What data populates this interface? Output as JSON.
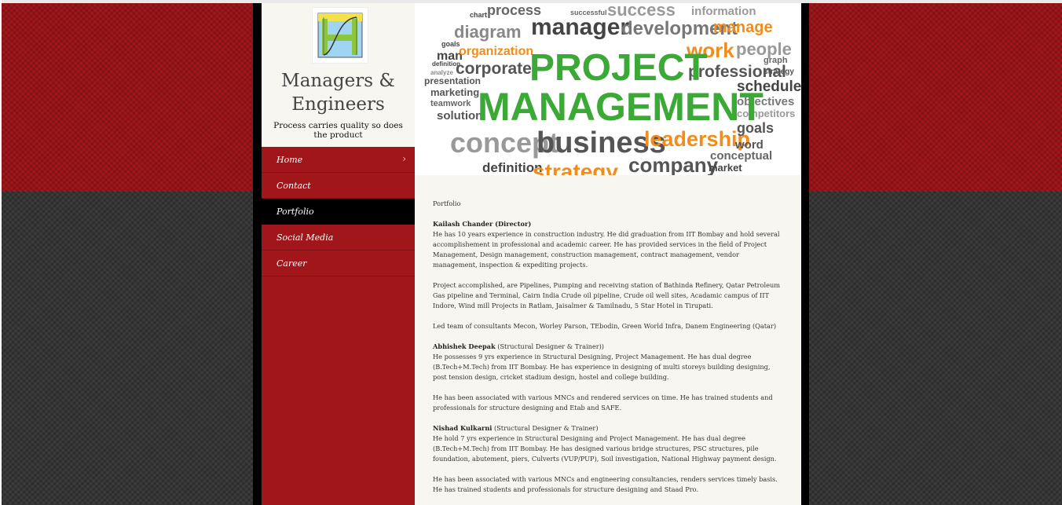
{
  "site": {
    "title": "Managers & Engineers",
    "tagline": "Process carries quality so does the product"
  },
  "nav": [
    {
      "label": "Home",
      "has_submenu": true,
      "active": false
    },
    {
      "label": "Contact",
      "has_submenu": false,
      "active": false
    },
    {
      "label": "Portfolio",
      "has_submenu": false,
      "active": true
    },
    {
      "label": "Social Media",
      "has_submenu": false,
      "active": false
    },
    {
      "label": "Career",
      "has_submenu": false,
      "active": false
    }
  ],
  "icons": {
    "submenu": "chevron-right-icon",
    "logo": "company-logo"
  },
  "colors": {
    "nav_bg": "#a0161b",
    "active_bg": "#000000",
    "content_bg": "#f8f6f0",
    "green": "#3aa935",
    "orange": "#f28c1b"
  },
  "banner": {
    "headline_1": "PROJECT",
    "headline_2": "MANAGEMENT",
    "words": {
      "process": "process",
      "success": "success",
      "chart": "chart",
      "successful": "successful",
      "information": "information",
      "diagram": "diagram",
      "manager": "manager",
      "development": "development",
      "manage": "manage",
      "goals": "goals",
      "man": "man",
      "organization": "organization",
      "work": "work",
      "people": "people",
      "definition": "definition",
      "corporate": "corporate",
      "professional": "professional",
      "graph": "graph",
      "strategy": "strategy",
      "analyze": "analyze",
      "presentation": "presentation",
      "schedule": "schedule",
      "marketing": "marketing",
      "objectives": "objectives",
      "teamwork": "teamwork",
      "solution": "solution",
      "competitors": "competitors",
      "concept": "concept",
      "business": "business",
      "leadership": "leadership",
      "word": "word",
      "company": "company",
      "conceptual": "conceptual",
      "market": "market"
    }
  },
  "portfolio": {
    "heading": "Portfolio",
    "p1_name": "Kailash Chander (Director)",
    "p1_bio": "He has 10 years experience in construction industry. He did graduation from IIT Bombay and hold several accomplishement in professional and academic career. He has provided services in the field of Project Management, Design management, construction management, contract management, vendor management, inspection & expediting projects.",
    "p1_projects": "Project accomplished, are Pipelines, Pumping and receiving station of Bathinda Refinery, Qatar Petroleum Gas pipeline and Terminal, Cairn India Crude oil pipeline, Crude oil well sites, Acadamic campus of IIT Indore, Wind mill Projects in Ratlam, Jaisalmer & Tamilnadu, 5 Star Hotel in Tirupati.",
    "p1_teams": "Led team of consultants Mecon, Worley Parson, TEbodin, Green World Infra, Danem Engineering (Qatar)",
    "p2_name": "Abhishek Deepak",
    "p2_role": " (Structural Designer & Trainer))",
    "p2_bio": "He possesses 9 yrs experience in Structural Designing, Project Management. He has dual degree (B.Tech+M.Tech) from IIT Bombay. He has experience in designing of multi storeys building designing, post tension design, cricket stadium design, hostel and college building.",
    "p2_assoc": "He has been associated with various MNCs and rendered services on time. He has trained students and professionals for structure designing and Etab and SAFE.",
    "p3_name": "Nishad Kulkarni",
    "p3_role": " (Structural Designer & Trainer)",
    "p3_bio": "He hold 7 yrs experience in Structural Designing and Project Management. He has dual degree (B.Tech+M.Tech) from IIT Bombay. He has designed various bridge structures, PSC structures, pile foundation, abutement, piers, Culverts (VUP/PUP), Soil investigation, National Highway payment design.",
    "p3_assoc": "He has been associated with various MNCs and engineering consultancies, renders services timely basis. He has trained students and professionals for structure designing and Staad Pro."
  }
}
